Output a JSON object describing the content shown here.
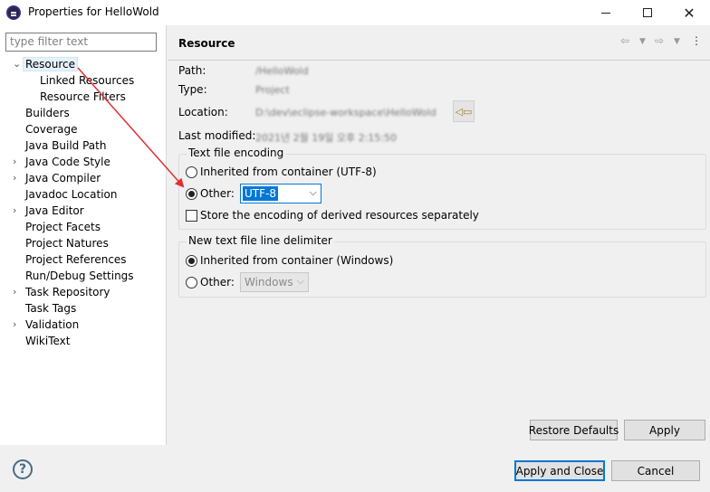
{
  "window": {
    "title": "Properties for HelloWold",
    "minimize_label": "",
    "close_label": "✕"
  },
  "filter": {
    "placeholder": "type filter text"
  },
  "tree": {
    "items": [
      {
        "label": "Resource",
        "expanded": true,
        "has_twisty": true,
        "selected": true,
        "indent": 0
      },
      {
        "label": "Linked Resources",
        "indent": 1
      },
      {
        "label": "Resource Filters",
        "indent": 1
      },
      {
        "label": "Builders",
        "indent": 0
      },
      {
        "label": "Coverage",
        "indent": 0
      },
      {
        "label": "Java Build Path",
        "indent": 0
      },
      {
        "label": "Java Code Style",
        "indent": 0,
        "has_twisty": true
      },
      {
        "label": "Java Compiler",
        "indent": 0,
        "has_twisty": true
      },
      {
        "label": "Javadoc Location",
        "indent": 0
      },
      {
        "label": "Java Editor",
        "indent": 0,
        "has_twisty": true
      },
      {
        "label": "Project Facets",
        "indent": 0
      },
      {
        "label": "Project Natures",
        "indent": 0
      },
      {
        "label": "Project References",
        "indent": 0
      },
      {
        "label": "Run/Debug Settings",
        "indent": 0
      },
      {
        "label": "Task Repository",
        "indent": 0,
        "has_twisty": true
      },
      {
        "label": "Task Tags",
        "indent": 0
      },
      {
        "label": "Validation",
        "indent": 0,
        "has_twisty": true
      },
      {
        "label": "WikiText",
        "indent": 0
      }
    ]
  },
  "page": {
    "title": "Resource",
    "path_label": "Path:",
    "path_value": "/HelloWold",
    "type_label": "Type:",
    "type_value": "Project",
    "location_label": "Location:",
    "location_value": "D:\\dev\\eclipse-workspace\\HelloWold",
    "modified_label": "Last modified:",
    "modified_value": "2021년 2월 19일 오후 2:15:50"
  },
  "encoding": {
    "group_title": "Text file encoding",
    "inherited_label": "Inherited from container (UTF-8)",
    "other_label": "Other:",
    "other_value": "UTF-8",
    "derived_label": "Store the encoding of derived resources separately"
  },
  "delimiter": {
    "group_title": "New text file line delimiter",
    "inherited_label": "Inherited from container (Windows)",
    "other_label": "Other:",
    "other_value": "Windows"
  },
  "buttons": {
    "restore_defaults": "Restore Defaults",
    "apply": "Apply",
    "apply_close": "Apply and Close",
    "cancel": "Cancel"
  },
  "help_glyph": "?",
  "colors": {
    "accent": "#0078d7",
    "arrow": "#e03030"
  }
}
